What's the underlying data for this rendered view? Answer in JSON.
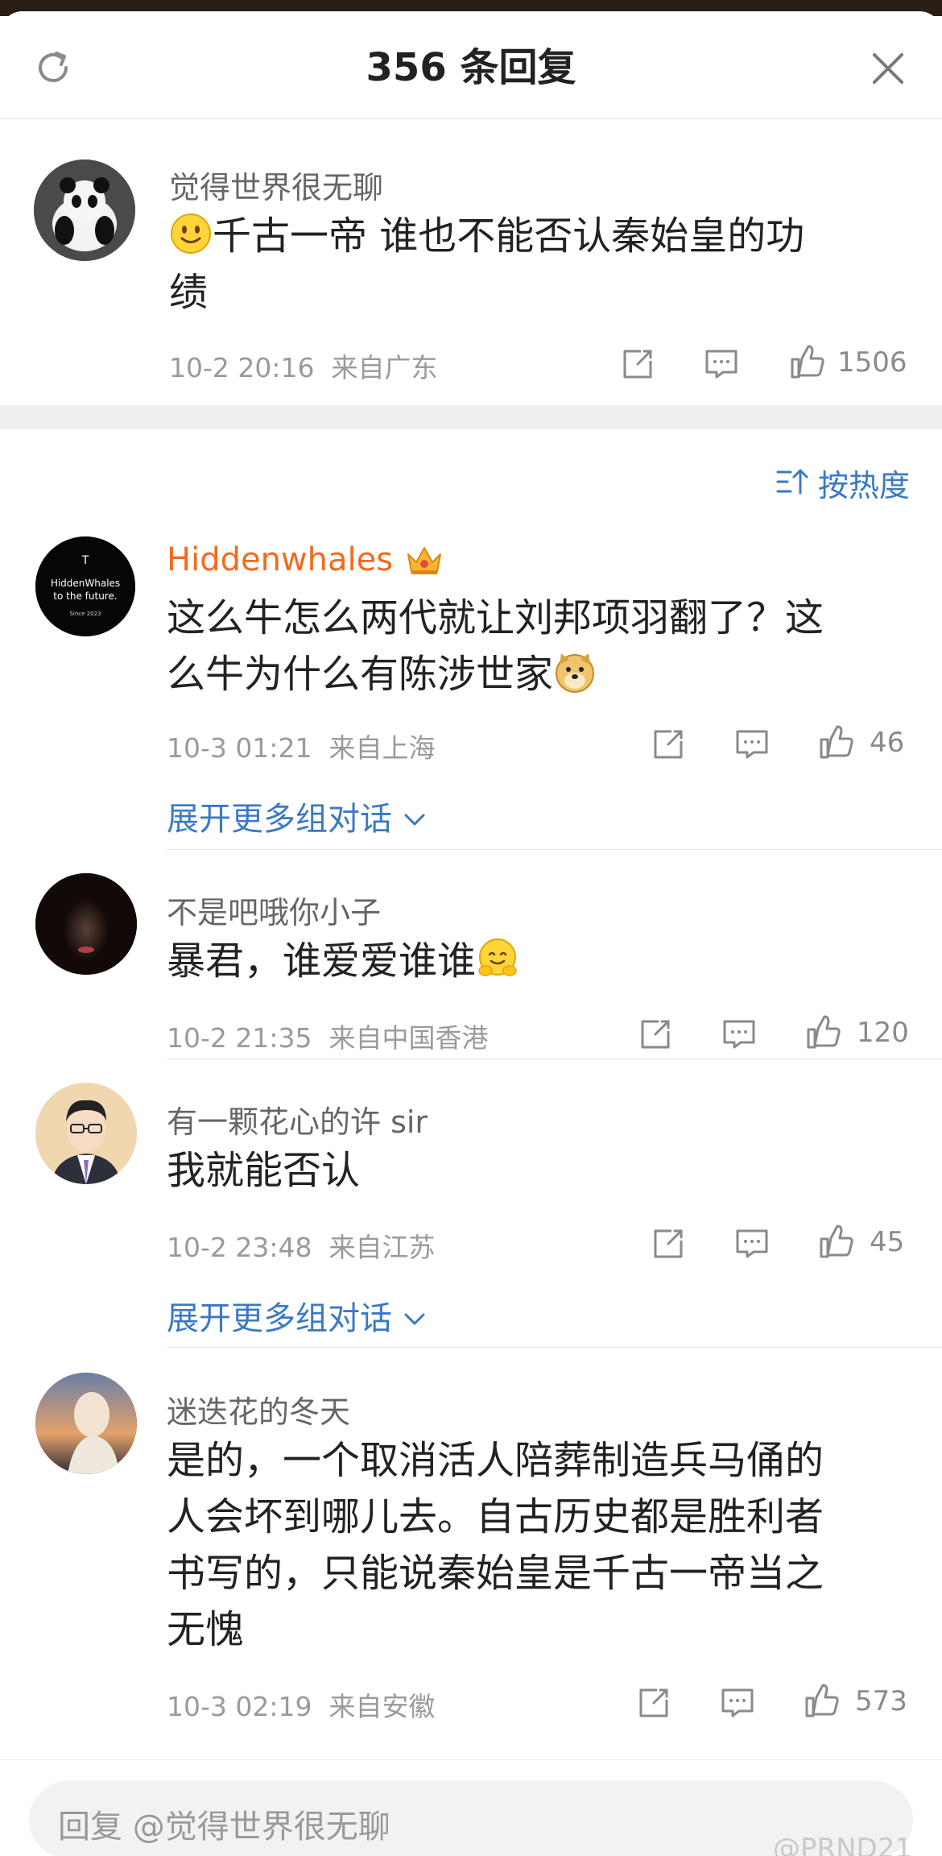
{
  "header": {
    "title": "356 条回复"
  },
  "main_comment": {
    "username": "觉得世界很无聊",
    "text_line1": "千古一帝 谁也不能否认秦始皇的功",
    "text_line2": "绩",
    "time": "10-2 20:16",
    "location": "来自广东",
    "likes": "1506"
  },
  "sort": {
    "label": "按热度"
  },
  "replies": [
    {
      "username": "Hiddenwhales",
      "avatar_text1": "HiddenWhales",
      "avatar_text2": "to the future.",
      "avatar_text3": "Since 2023",
      "text_line1": "这么牛怎么两代就让刘邦项羽翻了？这",
      "text_line2": "么牛为什么有陈涉世家",
      "time": "10-3 01:21",
      "location": "来自上海",
      "likes": "46",
      "expand": "展开更多组对话"
    },
    {
      "username": "不是吧哦你小子",
      "text_line1": "暴君，谁爱爱谁谁",
      "time": "10-2 21:35",
      "location": "来自中国香港",
      "likes": "120"
    },
    {
      "username": "有一颗花心的许 sir",
      "text_line1": "我就能否认",
      "time": "10-2 23:48",
      "location": "来自江苏",
      "likes": "45",
      "expand": "展开更多组对话"
    },
    {
      "username": "迷迭花的冬天",
      "text_line1": "是的，一个取消活人陪葬制造兵马俑的",
      "text_line2": "人会坏到哪儿去。自古历史都是胜利者",
      "text_line3": "书写的，只能说秦始皇是千古一帝当之",
      "text_line4": "无愧",
      "time": "10-3 02:19",
      "location": "来自安徽",
      "likes": "573"
    }
  ],
  "bottom": {
    "placeholder": "回复 @觉得世界很无聊",
    "watermark": "@PRND21"
  },
  "colors": {
    "link_blue": "#3b79c4",
    "vip_orange": "#f26b1d",
    "meta_gray": "#9a9a9a"
  },
  "icons": [
    "refresh-icon",
    "close-icon",
    "repost-icon",
    "comment-icon",
    "like-icon",
    "sort-icon",
    "chevron-down-icon",
    "crown-icon",
    "smile-emoji",
    "doge-emoji",
    "hug-emoji"
  ]
}
